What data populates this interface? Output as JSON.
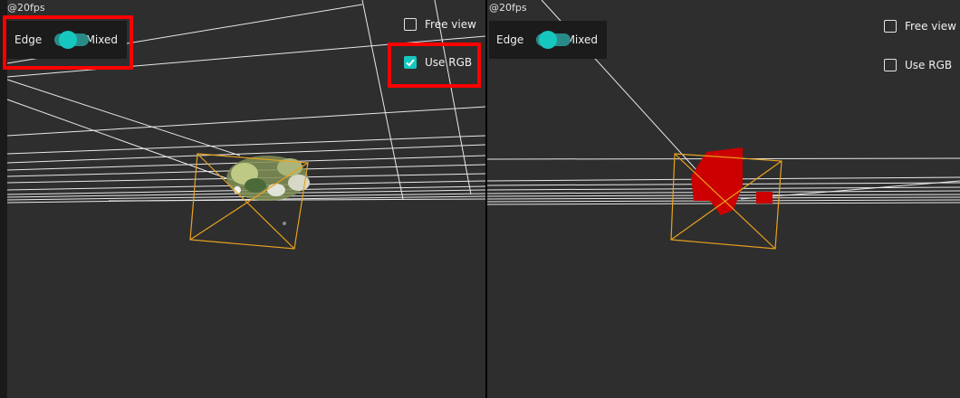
{
  "panels": [
    {
      "fps": "@20fps",
      "mode_left": "Edge",
      "mode_right": "Mixed",
      "free_view": "Free view",
      "use_rgb": "Use RGB",
      "use_rgb_checked": true,
      "free_view_checked": false
    },
    {
      "fps": "@20fps",
      "mode_left": "Edge",
      "mode_right": "Mixed",
      "free_view": "Free view",
      "use_rgb": "Use RGB",
      "use_rgb_checked": false,
      "free_view_checked": false
    }
  ],
  "colors": {
    "viewport_background": "#2e2e2e",
    "toggle_accent": "#16c7c0",
    "frustum": "#e8a21e",
    "highlight": "#ff0000",
    "object_red": "#cc0000"
  }
}
